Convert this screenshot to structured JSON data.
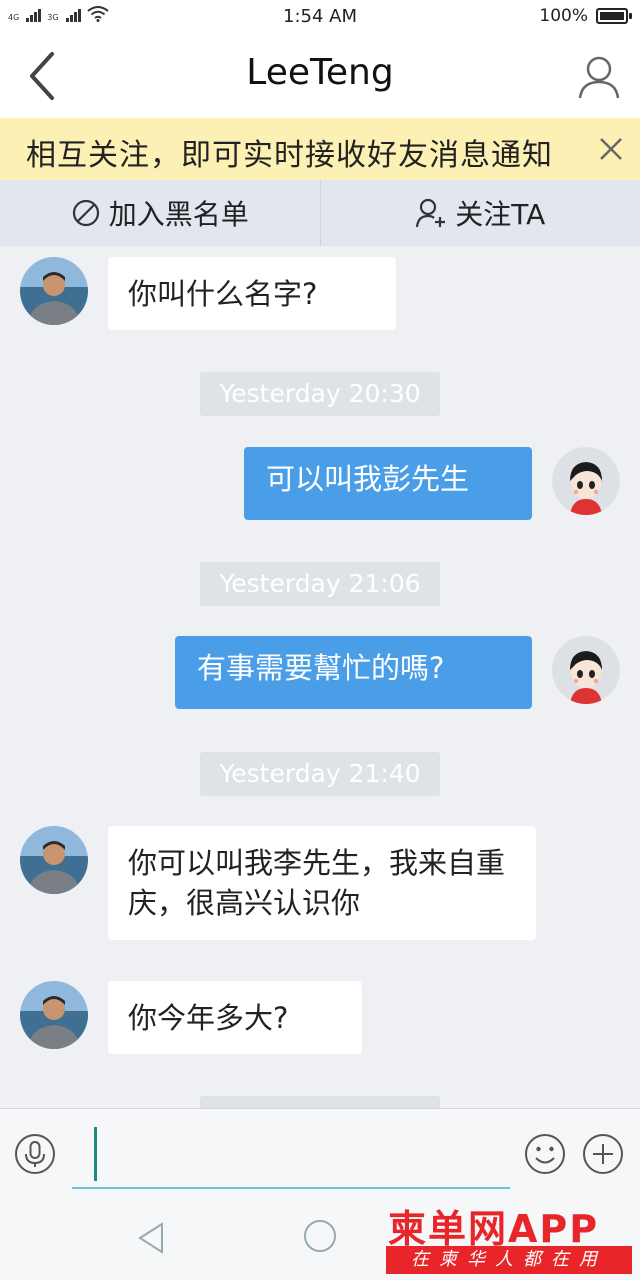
{
  "status_bar": {
    "net1": "4G",
    "net2": "3G",
    "time": "1:54 AM",
    "battery_text": "100%",
    "battery_level": 1.0
  },
  "header": {
    "title": "LeeTeng",
    "back_icon": "chevron-left-icon",
    "profile_icon": "person-icon"
  },
  "notice": {
    "text": "相互关注，即可实时接收好友消息通知"
  },
  "actions": {
    "blacklist_label": "加入黑名单",
    "follow_label": "关注TA"
  },
  "messages": [
    {
      "type": "in",
      "text": "你叫什么名字?"
    },
    {
      "type": "timestamp",
      "text": "Yesterday 20:30"
    },
    {
      "type": "out",
      "text": "可以叫我彭先生"
    },
    {
      "type": "timestamp",
      "text": "Yesterday 21:06"
    },
    {
      "type": "out",
      "text": "有事需要幫忙的嗎?"
    },
    {
      "type": "timestamp",
      "text": "Yesterday 21:40"
    },
    {
      "type": "in",
      "text": "你可以叫我李先生，我来自重庆，很高兴认识你"
    },
    {
      "type": "in",
      "text": "你今年多大?"
    }
  ],
  "input_bar": {
    "placeholder": "",
    "value": ""
  },
  "watermark": {
    "title": "柬单网APP",
    "subtitle": "在柬华人都在用"
  },
  "colors": {
    "outgoing_bubble": "#4a9ee8",
    "notice_bg": "#fdf0b4",
    "watermark_red": "#e8262a"
  }
}
